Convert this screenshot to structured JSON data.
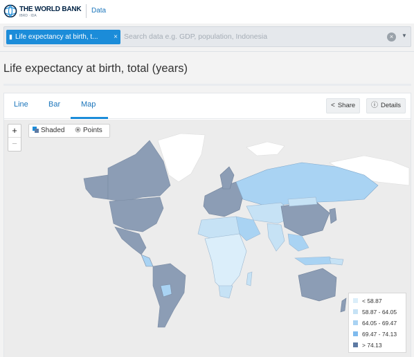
{
  "header": {
    "brand": "THE WORLD BANK",
    "brand_sub": "IBRD · IDA",
    "nav_data": "Data"
  },
  "search": {
    "chip_label": "Life expectancy at birth, t...",
    "placeholder": "Search data e.g. GDP, population, Indonesia"
  },
  "page": {
    "title": "Life expectancy at birth, total (years)"
  },
  "tabs": [
    {
      "label": "Line",
      "active": false
    },
    {
      "label": "Bar",
      "active": false
    },
    {
      "label": "Map",
      "active": true
    }
  ],
  "actions": {
    "share": "Share",
    "details": "Details"
  },
  "map": {
    "zoom_in": "+",
    "zoom_out": "−",
    "toggle_shaded": "Shaded",
    "toggle_points": "Points",
    "legend": [
      {
        "label": "< 58.87",
        "color": "#dbeefa"
      },
      {
        "label": "58.87 - 64.05",
        "color": "#c6e2f5"
      },
      {
        "label": "64.05 - 69.47",
        "color": "#a9d3f3"
      },
      {
        "label": "69.47 - 74.13",
        "color": "#7fbbee"
      },
      {
        "label": "> 74.13",
        "color": "#5d7aa3"
      }
    ],
    "colors": {
      "ocean": "#ececec",
      "no_data": "#ffffff",
      "high": "#8c9db5",
      "accent": "#1b8cd9"
    }
  }
}
